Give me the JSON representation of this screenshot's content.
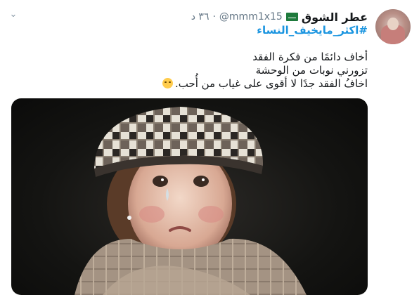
{
  "tweet": {
    "display_name": "عطر الشوق",
    "flag_icon": "saudi-flag-icon",
    "handle": "@mmm1x15",
    "separator": "·",
    "time": "٣٦ د",
    "hashtag": "#اكثر_مايخيف_النساء",
    "lines": [
      "أخاف دائمًا من فكرة الفقد",
      "تزورني نوبات من الوحشة",
      "اخافُ الفقد جدًا لا أقوى على غياب من أُحب."
    ],
    "emoji": "rolling-eyes-emoji-icon",
    "menu_icon": "chevron-down-icon",
    "media_description_icon": "photo-crying-child-in-plaid-cap"
  },
  "colors": {
    "text": "#14171a",
    "muted": "#657786",
    "link": "#1b95e0"
  }
}
